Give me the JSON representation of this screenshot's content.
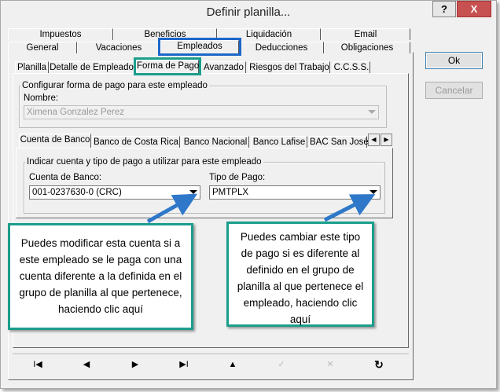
{
  "window": {
    "title": "Definir planilla...",
    "help_label": "?",
    "close_label": "X"
  },
  "top_tabs_row1": [
    "Impuestos",
    "Beneficios",
    "Liquidación",
    "Email"
  ],
  "top_tabs_row2": [
    "General",
    "Vacaciones",
    "Empleados",
    "Deducciones",
    "Obligaciones"
  ],
  "sub_tabs": [
    "Planilla",
    "Detalle de Empleado",
    "Forma de Pago",
    "Avanzado",
    "Riesgos del Trabajo",
    "C.C.S.S."
  ],
  "payment": {
    "group_title": "Configurar forma de pago para este empleado",
    "name_label": "Nombre:",
    "name_value": "Ximena Gonzalez Perez"
  },
  "bank_tabs": [
    "Cuenta de Banco",
    "Banco de Costa Rica",
    "Banco Nacional",
    "Banco Lafise",
    "BAC San José"
  ],
  "bank": {
    "group_title": "Indicar cuenta y tipo de pago a utilizar para este empleado",
    "account_label": "Cuenta de Banco:",
    "account_value": "001-0237630-0 (CRC)",
    "type_label": "Tipo de Pago:",
    "type_value": "PMTPLX"
  },
  "buttons": {
    "ok": "Ok",
    "cancel": "Cancelar"
  },
  "callouts": {
    "left": "Puedes modificar esta cuenta si a este empleado se le paga con una cuenta diferente a la definida en el grupo de planilla al que pertenece, haciendo clic aquí",
    "right": "Puedes cambiar este tipo de pago si es diferente al definido en el grupo de planilla al que pertenece el empleado, haciendo clic aquí"
  },
  "nav": {
    "first": "I◀",
    "prev": "◀",
    "next": "▶",
    "last": "▶I",
    "up": "▲",
    "confirm": "✓",
    "cancel": "✕",
    "refresh": "↻"
  },
  "colors": {
    "highlight_teal": "#1b9e8c",
    "highlight_blue": "#1d67c9",
    "arrow_blue": "#2f78c9"
  }
}
